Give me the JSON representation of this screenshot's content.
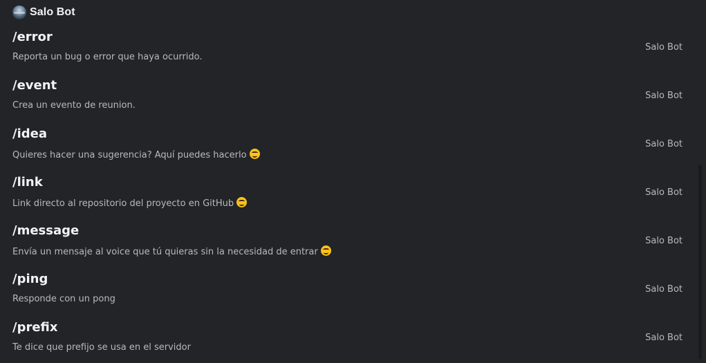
{
  "header": {
    "bot_name": "Salo Bot",
    "avatar_icon": "bot-avatar-icon"
  },
  "commands": [
    {
      "name": "/error",
      "description": "Reporta un bug o error que haya ocurrido.",
      "source": "Salo Bot",
      "emoji": ""
    },
    {
      "name": "/event",
      "description": "Crea un evento de reunion.",
      "source": "Salo Bot",
      "emoji": ""
    },
    {
      "name": "/idea",
      "description": "Quieres hacer una sugerencia? Aquí puedes hacerlo",
      "source": "Salo Bot",
      "emoji": "smiling-face-icon"
    },
    {
      "name": "/link",
      "description": "Link directo al repositorio del proyecto en GitHub",
      "source": "Salo Bot",
      "emoji": "smiling-face-icon"
    },
    {
      "name": "/message",
      "description": "Envía un mensaje al voice que tú quieras sin la necesidad de entrar",
      "source": "Salo Bot",
      "emoji": "winking-face-icon"
    },
    {
      "name": "/ping",
      "description": "Responde con un pong",
      "source": "Salo Bot",
      "emoji": ""
    },
    {
      "name": "/prefix",
      "description": "Te dice que prefijo se usa en el servidor",
      "source": "Salo Bot",
      "emoji": ""
    }
  ],
  "colors": {
    "background": "#232428",
    "title_text": "#f2f3f5",
    "muted_text": "#b5bac1",
    "scrollbar_thumb": "#1a1b1e"
  }
}
